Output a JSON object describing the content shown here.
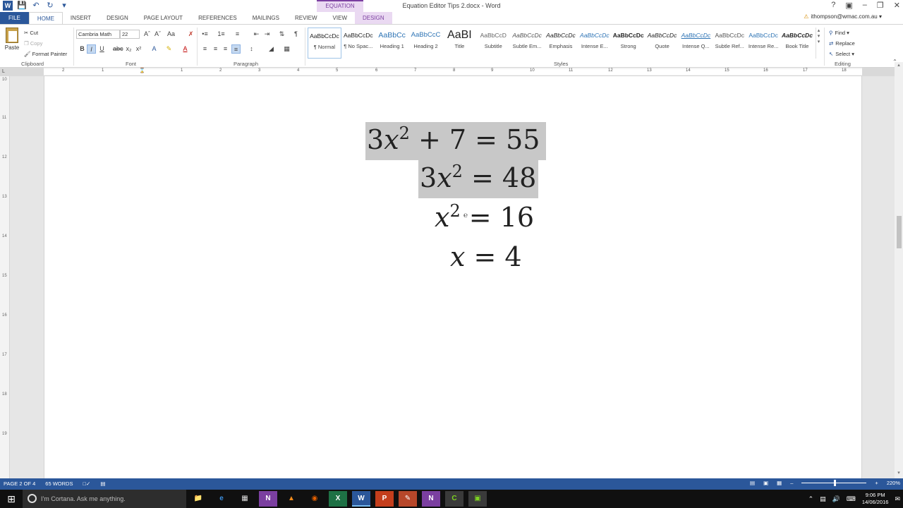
{
  "window": {
    "title": "Equation Editor Tips 2.docx - Word",
    "contextual_group": "EQUATION TOOLS",
    "user": "ithompson@wmac.com.au"
  },
  "tabs": [
    "FILE",
    "HOME",
    "INSERT",
    "DESIGN",
    "PAGE LAYOUT",
    "REFERENCES",
    "MAILINGS",
    "REVIEW",
    "VIEW",
    "DESIGN"
  ],
  "clipboard": {
    "paste": "Paste",
    "cut": "Cut",
    "copy": "Copy",
    "format_painter": "Format Painter",
    "label": "Clipboard"
  },
  "font": {
    "name": "Cambria Math",
    "size": "22",
    "label": "Font"
  },
  "paragraph": {
    "label": "Paragraph"
  },
  "styles": {
    "label": "Styles",
    "items": [
      {
        "preview": "AaBbCcDc",
        "name": "¶ Normal"
      },
      {
        "preview": "AaBbCcDc",
        "name": "¶ No Spac..."
      },
      {
        "preview": "AaBbCc",
        "name": "Heading 1"
      },
      {
        "preview": "AaBbCcC",
        "name": "Heading 2"
      },
      {
        "preview": "AaBI",
        "name": "Title"
      },
      {
        "preview": "AaBbCcD",
        "name": "Subtitle"
      },
      {
        "preview": "AaBbCcDc",
        "name": "Subtle Em..."
      },
      {
        "preview": "AaBbCcDc",
        "name": "Emphasis"
      },
      {
        "preview": "AaBbCcDc",
        "name": "Intense E..."
      },
      {
        "preview": "AaBbCcDc",
        "name": "Strong"
      },
      {
        "preview": "AaBbCcDc",
        "name": "Quote"
      },
      {
        "preview": "AaBbCcDc",
        "name": "Intense Q..."
      },
      {
        "preview": "AaBbCcDc",
        "name": "Subtle Ref..."
      },
      {
        "preview": "AaBbCcDc",
        "name": "Intense Re..."
      },
      {
        "preview": "AaBbCcDc",
        "name": "Book Title"
      }
    ]
  },
  "editing": {
    "find": "Find",
    "replace": "Replace",
    "select": "Select",
    "label": "Editing"
  },
  "ruler_numbers": [
    "2",
    "1",
    "1",
    "2",
    "3",
    "4",
    "5",
    "6",
    "7",
    "8",
    "9",
    "10",
    "11",
    "12",
    "13",
    "14",
    "15",
    "16",
    "17",
    "18"
  ],
  "vruler_numbers": [
    "10",
    "11",
    "12",
    "13",
    "14",
    "15",
    "16",
    "17",
    "18",
    "19"
  ],
  "equations": [
    {
      "coef": "3",
      "var": "x",
      "exp": "2",
      "rest": " + 7 = 55"
    },
    {
      "coef": "3",
      "var": "x",
      "exp": "2",
      "rest": " = 48"
    },
    {
      "coef": "",
      "var": "x",
      "exp": "2",
      "rest": " = 16"
    },
    {
      "coef": "",
      "var": "x",
      "exp": "",
      "rest": " = 4"
    }
  ],
  "status": {
    "page": "PAGE 2 OF 4",
    "words": "65 WORDS",
    "zoom": "220%"
  },
  "taskbar": {
    "cortana": "I'm Cortana. Ask me anything.",
    "time": "9:06 PM",
    "date": "14/06/2016"
  },
  "colors": {
    "word_blue": "#2b579a",
    "eq_tools_purple": "#7b3fa0",
    "selection_gray": "#c8c8c8"
  }
}
